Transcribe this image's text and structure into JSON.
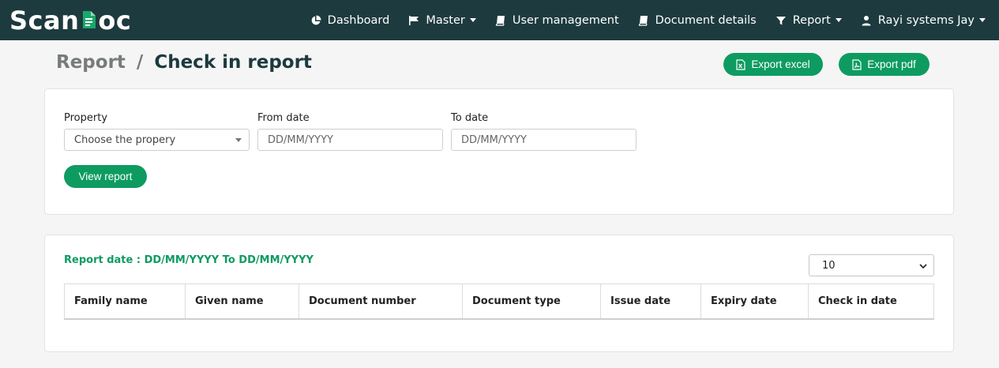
{
  "brand": {
    "name_left": "Scan",
    "name_right": "oc",
    "accent": "#0e9b61",
    "nav_bg": "#1d3a3e"
  },
  "nav": {
    "items": [
      {
        "label": "Dashboard",
        "icon": "pie-chart-icon"
      },
      {
        "label": "Master",
        "icon": "flag-icon",
        "dropdown": true
      },
      {
        "label": "User management",
        "icon": "book-icon"
      },
      {
        "label": "Document details",
        "icon": "book-icon"
      },
      {
        "label": "Report",
        "icon": "filter-icon",
        "dropdown": true
      },
      {
        "label": "Rayi systems Jay",
        "icon": "user-icon",
        "dropdown": true
      }
    ]
  },
  "breadcrumb": {
    "parent": "Report",
    "separator": "/",
    "current": "Check in report"
  },
  "actions": {
    "export_excel": "Export excel",
    "export_pdf": "Export pdf"
  },
  "filters": {
    "property_label": "Property",
    "property_value": "Choose the propery",
    "from_label": "From date",
    "from_placeholder": "DD/MM/YYYY",
    "to_label": "To date",
    "to_placeholder": "DD/MM/YYYY",
    "view_button": "View report"
  },
  "report": {
    "date_range": "Report date : DD/MM/YYYY To DD/MM/YYYY",
    "page_size": "10",
    "columns": [
      "Family name",
      "Given name",
      "Document number",
      "Document type",
      "Issue date",
      "Expiry date",
      "Check in date"
    ]
  }
}
